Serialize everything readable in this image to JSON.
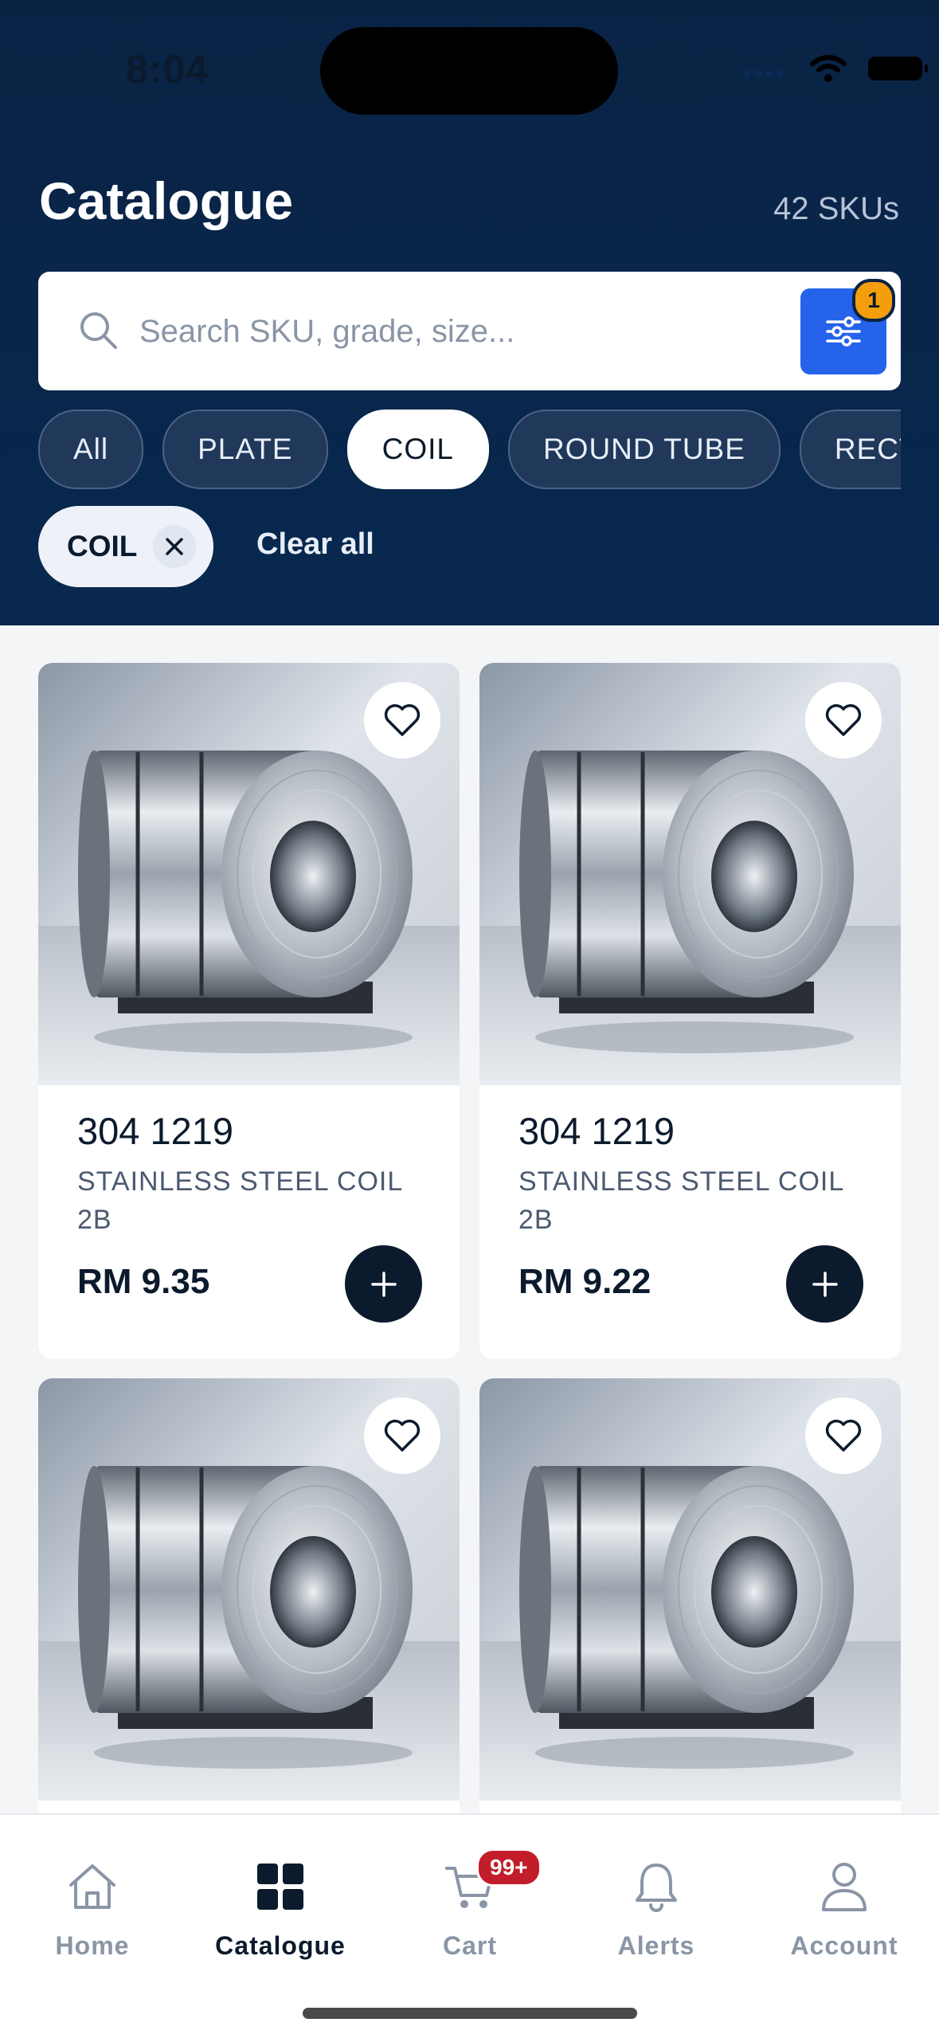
{
  "status_bar": {
    "time": "8:04"
  },
  "header": {
    "title": "Catalogue",
    "sku_count": "42 SKUs"
  },
  "search": {
    "placeholder": "Search SKU, grade, size...",
    "filter_count": "1"
  },
  "categories": [
    {
      "label": "All",
      "active": false
    },
    {
      "label": "PLATE",
      "active": false
    },
    {
      "label": "COIL",
      "active": true
    },
    {
      "label": "ROUND TUBE",
      "active": false
    },
    {
      "label": "RECT",
      "active": false
    }
  ],
  "active_filters": {
    "chip_label": "COIL",
    "clear_label": "Clear all"
  },
  "products": [
    {
      "sku": "304 1219",
      "name_line1": "STAINLESS STEEL COIL",
      "name_line2": "2B",
      "price": "RM 9.35"
    },
    {
      "sku": "304 1219",
      "name_line1": "STAINLESS STEEL COIL",
      "name_line2": "2B",
      "price": "RM 9.22"
    },
    {
      "sku": "",
      "name_line1": "",
      "name_line2": "",
      "price": ""
    },
    {
      "sku": "",
      "name_line1": "",
      "name_line2": "",
      "price": ""
    }
  ],
  "tabbar": {
    "home": "Home",
    "catalogue": "Catalogue",
    "cart": "Cart",
    "cart_badge": "99+",
    "alerts": "Alerts",
    "account": "Account"
  },
  "colors": {
    "header_bg": "#0a2345",
    "accent_blue": "#2563eb",
    "badge_amber": "#f59e0b",
    "cart_badge_red": "#c21d2a",
    "dark_navy": "#0b1a2c"
  }
}
